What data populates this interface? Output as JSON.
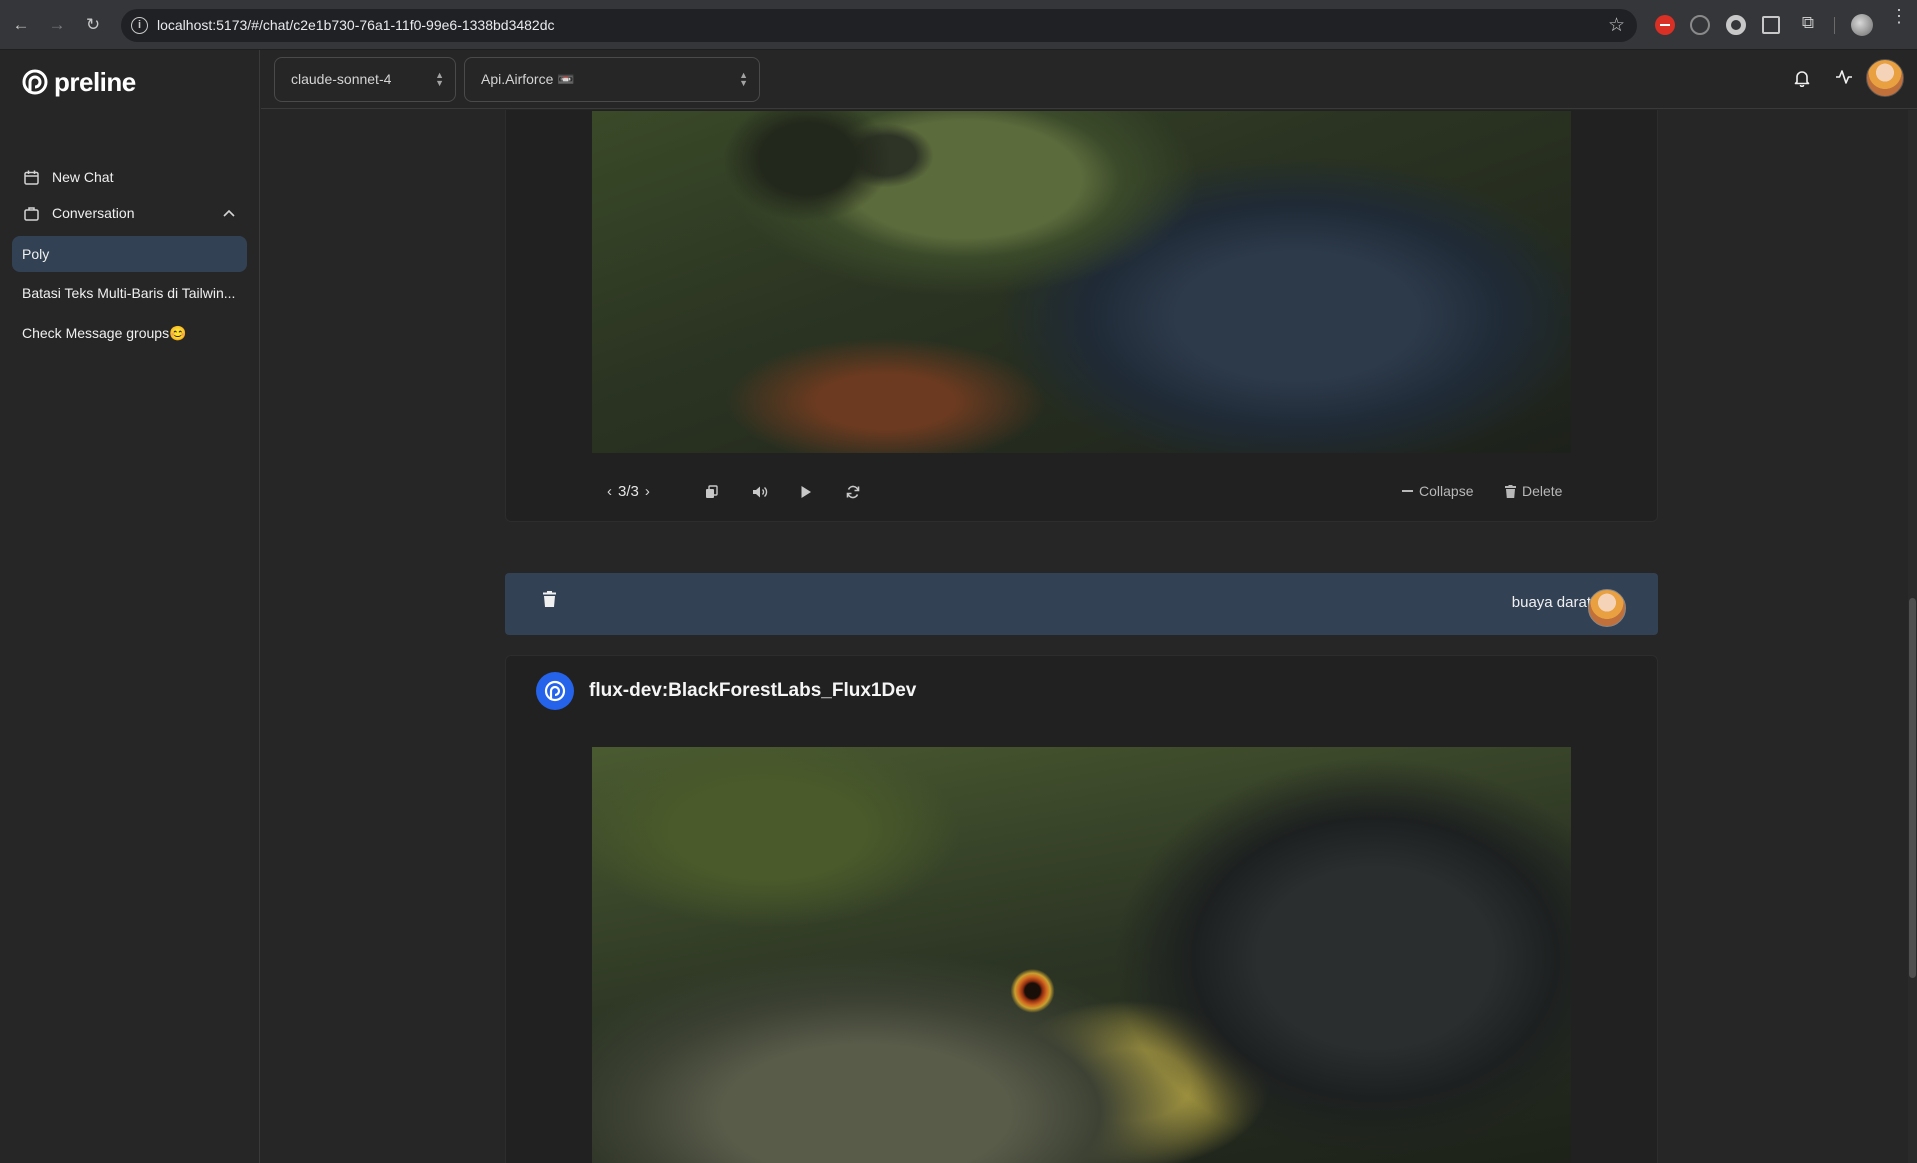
{
  "browser": {
    "url": "localhost:5173/#/chat/c2e1b730-76a1-11f0-99e6-1338bd3482dc"
  },
  "sidebar": {
    "logo": "preline",
    "new_chat": "New Chat",
    "conversation_label": "Conversation",
    "conversations": [
      {
        "label": "Poly",
        "active": true
      },
      {
        "label": "Batasi Teks Multi-Baris di Tailwin...",
        "active": false
      },
      {
        "label": "Check Message groups😊",
        "active": false
      }
    ]
  },
  "topbar": {
    "model_select": "claude-sonnet-4",
    "provider_select": "Api.Airforce 📼"
  },
  "messages": {
    "prev_response": {
      "pager": "3/3",
      "collapse_label": "Collapse",
      "delete_label": "Delete"
    },
    "user_message": {
      "text": "buaya darat"
    },
    "bot_response": {
      "model_name": "flux-dev:BlackForestLabs_Flux1Dev"
    }
  },
  "colors": {
    "accent": "#2563eb",
    "active_item": "#334155",
    "background": "#262626"
  }
}
